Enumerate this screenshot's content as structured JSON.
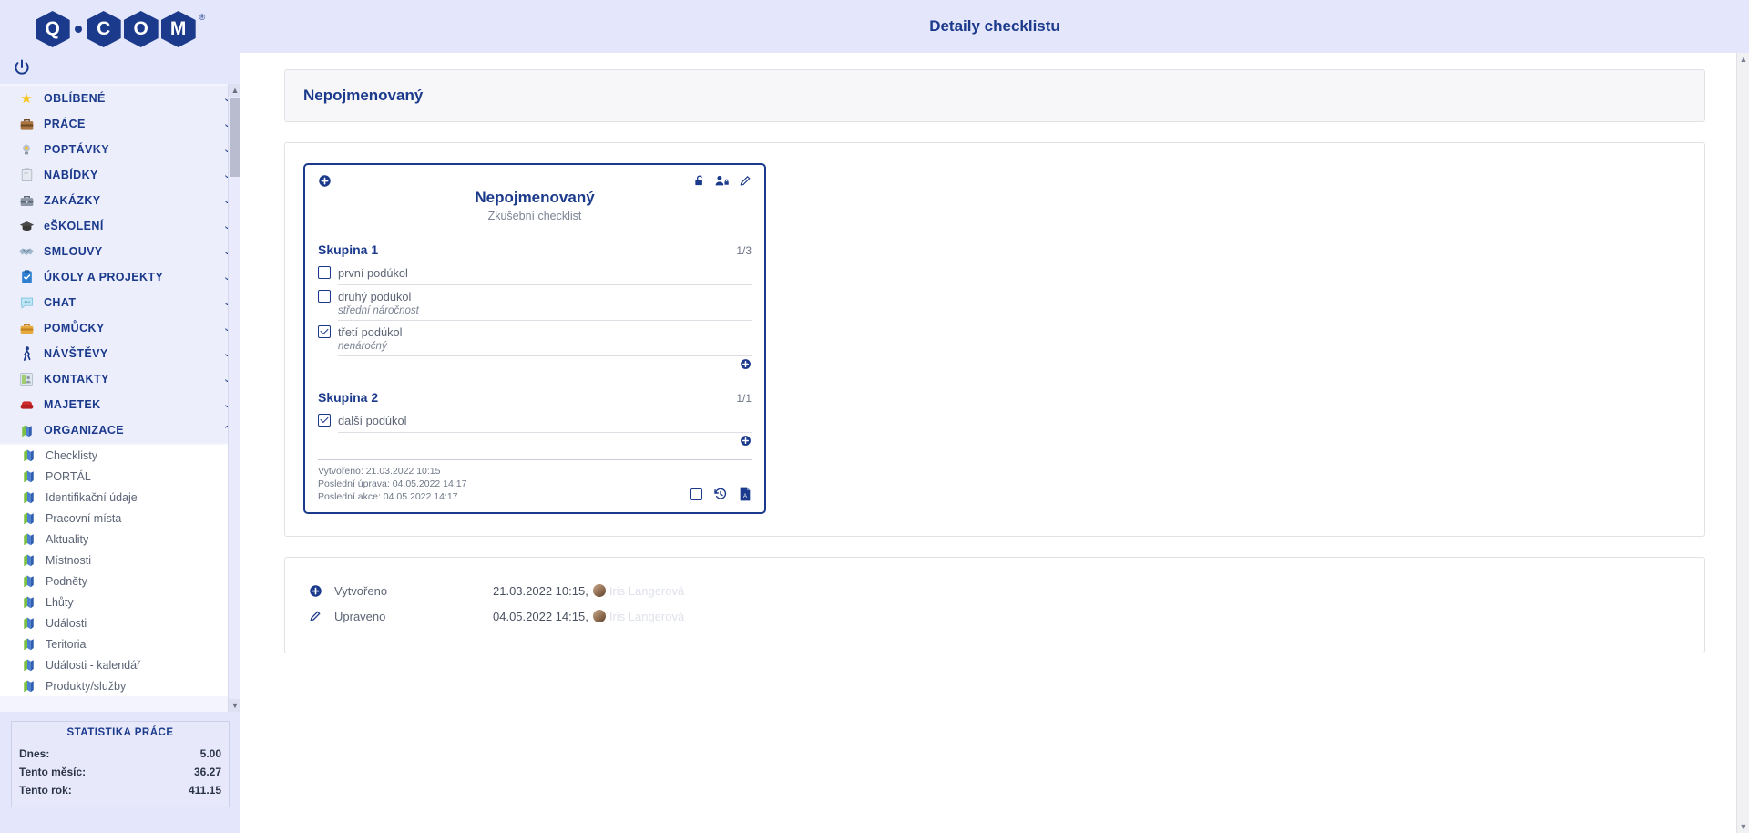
{
  "brand": {
    "letters": [
      "Q",
      "C",
      "O",
      "M"
    ],
    "registered": "®",
    "power_icon": "power-icon"
  },
  "colors": {
    "accent": "#1b3a8c",
    "sidebar_bg": "#e4e6fb",
    "panel_bg": "#f7f7f9",
    "muted_text": "#6d7587"
  },
  "topbar": {
    "title": "Detaily checklistu"
  },
  "sidebar": {
    "items": [
      {
        "label": "OBLÍBENÉ",
        "icon": "star-icon",
        "expanded": false
      },
      {
        "label": "PRÁCE",
        "icon": "briefcase-icon",
        "expanded": false
      },
      {
        "label": "POPTÁVKY",
        "icon": "lightbulb-icon",
        "expanded": false
      },
      {
        "label": "NABÍDKY",
        "icon": "clipboard-icon",
        "expanded": false
      },
      {
        "label": "ZAKÁZKY",
        "icon": "suitcase-icon",
        "expanded": false
      },
      {
        "label": "eŠKOLENÍ",
        "icon": "graduation-cap-icon",
        "expanded": false
      },
      {
        "label": "SMLOUVY",
        "icon": "handshake-icon",
        "expanded": false
      },
      {
        "label": "ÚKOLY A PROJEKTY",
        "icon": "checklist-icon",
        "expanded": false
      },
      {
        "label": "CHAT",
        "icon": "speech-bubble-icon",
        "expanded": false
      },
      {
        "label": "POMŮCKY",
        "icon": "toolbox-icon",
        "expanded": false
      },
      {
        "label": "NÁVŠTĚVY",
        "icon": "walking-person-icon",
        "expanded": false
      },
      {
        "label": "KONTAKTY",
        "icon": "contacts-icon",
        "expanded": false
      },
      {
        "label": "MAJETEK",
        "icon": "armchair-icon",
        "expanded": false
      },
      {
        "label": "ORGANIZACE",
        "icon": "organization-icon",
        "expanded": true
      }
    ],
    "subitems": [
      {
        "label": "Checklisty",
        "icon": "organization-icon"
      },
      {
        "label": "PORTÁL",
        "icon": "organization-icon"
      },
      {
        "label": "Identifikační údaje",
        "icon": "organization-icon"
      },
      {
        "label": "Pracovní místa",
        "icon": "organization-icon"
      },
      {
        "label": "Aktuality",
        "icon": "organization-icon"
      },
      {
        "label": "Místnosti",
        "icon": "organization-icon"
      },
      {
        "label": "Podněty",
        "icon": "organization-icon"
      },
      {
        "label": "Lhůty",
        "icon": "organization-icon"
      },
      {
        "label": "Události",
        "icon": "organization-icon"
      },
      {
        "label": "Teritoria",
        "icon": "organization-icon"
      },
      {
        "label": "Události - kalendář",
        "icon": "organization-icon"
      },
      {
        "label": "Produkty/služby",
        "icon": "organization-icon"
      }
    ],
    "chevron_collapsed": "⌄",
    "chevron_expanded": "⌃",
    "stats": {
      "title": "STATISTIKA PRÁCE",
      "rows": [
        {
          "label": "Dnes:",
          "value": "5.00"
        },
        {
          "label": "Tento měsíc:",
          "value": "36.27"
        },
        {
          "label": "Tento rok:",
          "value": "411.15"
        }
      ]
    }
  },
  "page": {
    "title": "Nepojmenovaný"
  },
  "checklist_card": {
    "add_icon": "plus-circle-icon",
    "tools": [
      {
        "name": "unlock-icon",
        "glyph": "unlock"
      },
      {
        "name": "user-lock-icon",
        "glyph": "user-lock"
      },
      {
        "name": "edit-pencil-icon",
        "glyph": "pencil"
      }
    ],
    "title": "Nepojmenovaný",
    "subtitle": "Zkušební checklist",
    "groups": [
      {
        "name": "Skupina 1",
        "count": "1/3",
        "tasks": [
          {
            "label": "první podúkol",
            "note": "",
            "checked": false
          },
          {
            "label": "druhý podúkol",
            "note": "střední náročnost",
            "checked": false
          },
          {
            "label": "třetí podúkol",
            "note": "nenáročný",
            "checked": true
          }
        ]
      },
      {
        "name": "Skupina 2",
        "count": "1/1",
        "tasks": [
          {
            "label": "další podúkol",
            "note": "",
            "checked": true
          }
        ]
      }
    ],
    "meta": {
      "created": "Vytvořeno: 21.03.2022 10:15",
      "last_edit": "Poslední úprava: 04.05.2022 14:17",
      "last_action": "Poslední akce: 04.05.2022 14:17"
    },
    "footer_icons": [
      {
        "name": "select-checkbox",
        "glyph": "box"
      },
      {
        "name": "history-icon",
        "glyph": "history"
      },
      {
        "name": "pdf-export-icon",
        "glyph": "pdf"
      }
    ]
  },
  "activity": {
    "rows": [
      {
        "icon": "plus-circle-icon",
        "label": "Vytvořeno",
        "datetime": "21.03.2022 10:15,",
        "user": "Iris Langerová"
      },
      {
        "icon": "edit-pencil-icon",
        "label": "Upraveno",
        "datetime": "04.05.2022 14:15,",
        "user": "Iris Langerová"
      }
    ]
  },
  "scrollbars": {
    "up_arrow": "▲",
    "down_arrow": "▼"
  }
}
